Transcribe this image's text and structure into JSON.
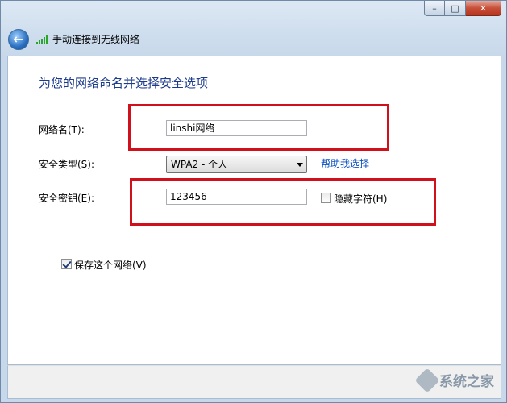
{
  "window": {
    "title": "手动连接到无线网络",
    "caption": {
      "minimize": "–",
      "maximize": "□",
      "close": "✕"
    },
    "back_glyph": "←"
  },
  "page": {
    "heading": "为您的网络命名并选择安全选项"
  },
  "form": {
    "network_name": {
      "label": "网络名(T):",
      "value": "linshi网络"
    },
    "security_type": {
      "label": "安全类型(S):",
      "value": "WPA2 - 个人",
      "help_link": "帮助我选择"
    },
    "security_key": {
      "label": "安全密钥(E):",
      "value": "123456",
      "hide_chars_label": "隐藏字符(H)",
      "hide_chars_checked": false
    },
    "save_network": {
      "label": "保存这个网络(V)",
      "checked": true
    }
  },
  "watermark": {
    "text": "系统之家"
  },
  "colors": {
    "heading": "#1e3c8c",
    "link": "#0b4fc1",
    "annotation": "#d0101a"
  }
}
